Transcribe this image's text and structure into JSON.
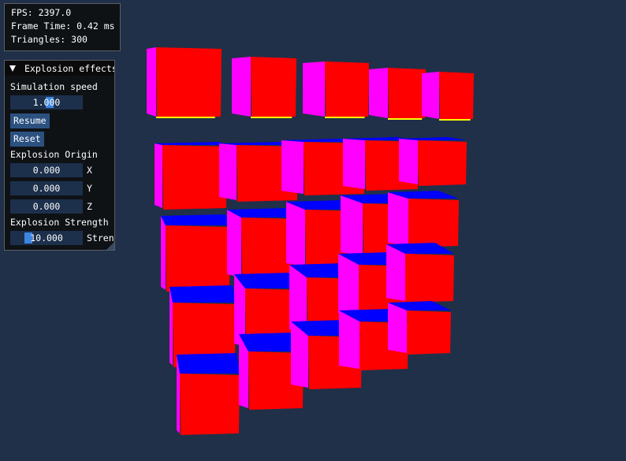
{
  "stats": {
    "fps": "FPS: 2397.0",
    "frame_time": "Frame Time: 0.42 ms",
    "triangles": "Triangles: 300"
  },
  "panel": {
    "title": "Explosion effects",
    "simulation_speed_label": "Simulation speed",
    "simulation_speed_value": "1.000",
    "simulation_speed_fraction": 0.5,
    "resume_label": "Resume",
    "reset_label": "Reset",
    "origin_label": "Explosion Origin",
    "origin_x": "0.000",
    "origin_y": "0.000",
    "origin_z": "0.000",
    "axis_x": "X",
    "axis_y": "Y",
    "axis_z": "Z",
    "strength_label": "Explosion Strength",
    "strength_value": "10.000",
    "strength_axis_label": "Strength"
  },
  "scene": {
    "cube_count": 25,
    "colors": {
      "background": "#1f3048",
      "front_face": "#ff0000",
      "side_face": "#ff00ff",
      "top_face": "#0000ff",
      "bottom_edge": "#ffff00",
      "panel_bg": "#0f1012",
      "widget_bg": "#1c2f4b",
      "button_bg": "#2a5180",
      "slider_grab": "#3d85e0"
    }
  }
}
